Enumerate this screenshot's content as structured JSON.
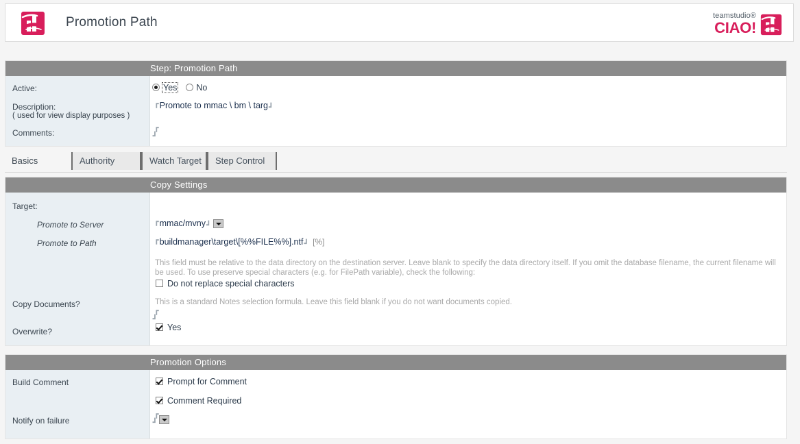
{
  "header": {
    "title": "Promotion Path",
    "logo_icon": "ciao-app-icon",
    "brand_top": "teamstudio®",
    "brand_bottom": "CIAO!",
    "brand_color": "#d81e5b"
  },
  "step_panel": {
    "caption": "Step:  Promotion Path",
    "active": {
      "label": "Active:",
      "options": [
        {
          "label": "Yes",
          "selected": true,
          "focused": true
        },
        {
          "label": "No",
          "selected": false,
          "focused": false
        }
      ]
    },
    "description": {
      "label": "Description:",
      "sublabel": "( used for view display purposes )",
      "value": "Promote to mmac \\ bm \\ targ"
    },
    "comments": {
      "label": "Comments:",
      "value": ""
    }
  },
  "tabs": [
    {
      "label": "Basics",
      "active": true
    },
    {
      "label": "Authority",
      "active": false
    },
    {
      "label": "Watch Target",
      "active": false
    },
    {
      "label": "Step Control",
      "active": false
    }
  ],
  "copy_settings": {
    "caption": "Copy Settings",
    "target_label": "Target:",
    "promote_to_server": {
      "label": "Promote to Server",
      "value": "mmac/mvny",
      "dropdown_icon": "chevron-down-icon"
    },
    "promote_to_path": {
      "label": "Promote to Path",
      "value": "buildmanager\\target\\[%%FILE%%].ntf",
      "suffix": "[%]"
    },
    "path_help": "This field must be relative to the data directory on the destination server. Leave blank to specify the data directory itself. If you omit the database filename, the current filename will be used. To use preserve special characters (e.g. for FilePath variable), check the following:",
    "special_chars": {
      "label": "Do not replace special characters",
      "checked": false
    },
    "copy_documents": {
      "label": "Copy Documents?",
      "help": "This is a standard Notes selection formula. Leave this field blank if you do not want documents copied.",
      "value": ""
    },
    "overwrite": {
      "label": "Overwrite?",
      "option_label": "Yes",
      "checked": true
    }
  },
  "promotion_options": {
    "caption": "Promotion Options",
    "build_comment_label": "Build Comment",
    "prompt_for_comment": {
      "label": "Prompt for Comment",
      "checked": true
    },
    "comment_required": {
      "label": "Comment Required",
      "checked": true
    },
    "notify_on_failure": {
      "label": "Notify on failure",
      "value": "",
      "dropdown_icon": "chevron-down-icon"
    }
  }
}
